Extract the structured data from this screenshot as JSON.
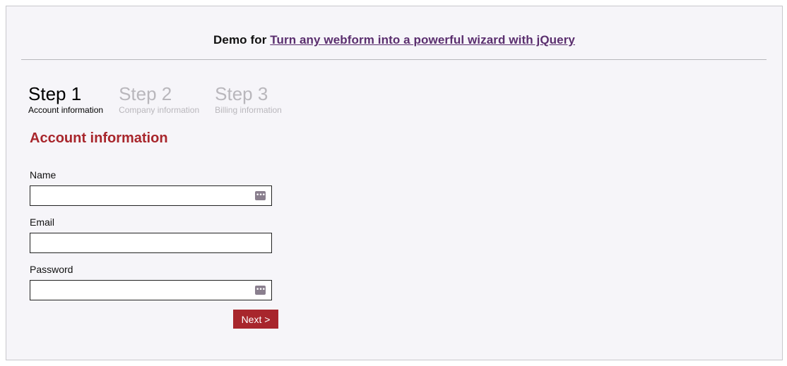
{
  "header": {
    "prefix": "Demo for",
    "link_text": "Turn any webform into a powerful wizard with jQuery"
  },
  "steps": [
    {
      "title": "Step 1",
      "subtitle": "Account information",
      "active": true
    },
    {
      "title": "Step 2",
      "subtitle": "Company information",
      "active": false
    },
    {
      "title": "Step 3",
      "subtitle": "Billing information",
      "active": false
    }
  ],
  "form": {
    "section_title": "Account information",
    "fields": [
      {
        "label": "Name",
        "value": "",
        "icon": "password-manager-icon"
      },
      {
        "label": "Email",
        "value": ""
      },
      {
        "label": "Password",
        "value": "",
        "icon": "password-manager-icon"
      }
    ],
    "next_label": "Next >"
  },
  "colors": {
    "accent": "#a8262c",
    "link": "#5a2e6e",
    "inactive_step": "#b9b7bc",
    "background": "#f6f5f9"
  }
}
